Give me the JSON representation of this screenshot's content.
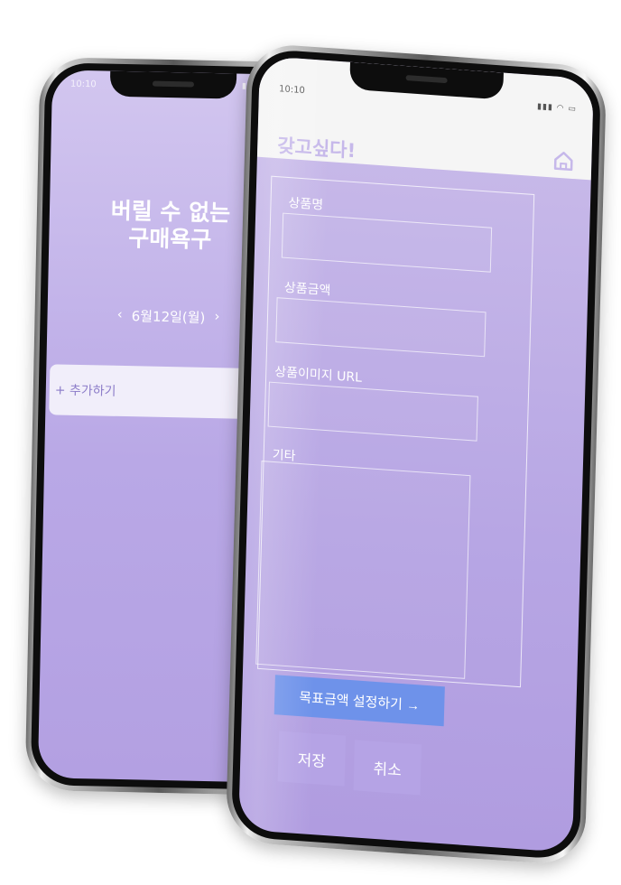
{
  "left_phone": {
    "status_time": "10:10",
    "status_icons": "▮▮▮ ◠ ▭",
    "title": "버릴 수 없는\n구매욕구",
    "date_prev": "‹",
    "date_label": "6월12일(월)",
    "date_next": "›",
    "add_item": "+ 추가하기"
  },
  "right_phone": {
    "status_time": "10:10",
    "status_icons": "▮▮▮ ◠ ▭",
    "app_title": "갖고싶다!",
    "fields": {
      "product_name_label": "상품명",
      "product_price_label": "상품금액",
      "product_image_label": "상품이미지 URL",
      "etc_label": "기타"
    },
    "goal_button": "목표금액 설정하기 →",
    "save_button": "저장",
    "cancel_button": "취소"
  },
  "colors": {
    "screen_purple": "#b9a8e6",
    "card_white": "#f1eefa",
    "goal_blue": "#6e92ea",
    "button_purple": "#b5a3e5"
  },
  "icons": {
    "home": "home-icon"
  }
}
